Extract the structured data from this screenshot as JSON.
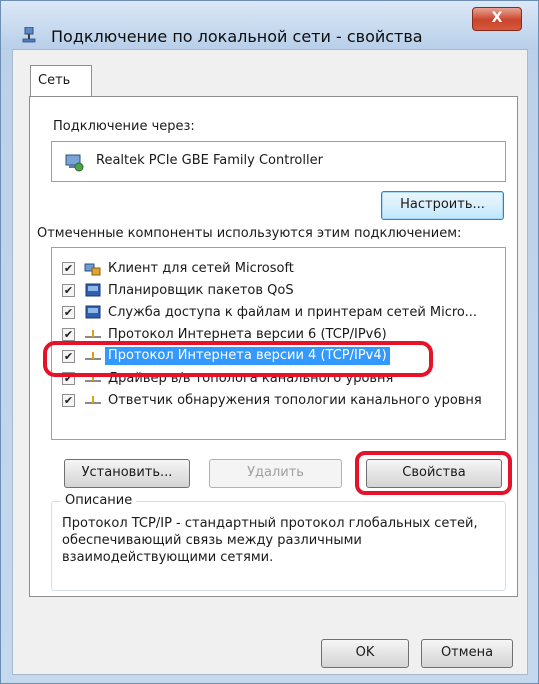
{
  "window": {
    "title": "Подключение по локальной сети - свойства",
    "close_label": "X"
  },
  "tabs": [
    {
      "label": "Сеть",
      "selected": true
    }
  ],
  "connect_using": {
    "label": "Подключение через:",
    "adapter_name": "Realtek PCIe GBE Family Controller",
    "configure_button": "Настроить..."
  },
  "components": {
    "label": "Отмеченные компоненты используются этим подключением:",
    "items": [
      {
        "label": "Клиент для сетей Microsoft",
        "checked": true,
        "icon": "network-client-icon",
        "selected": false
      },
      {
        "label": "Планировщик пакетов QoS",
        "checked": true,
        "icon": "network-service-icon",
        "selected": false
      },
      {
        "label": "Служба доступа к файлам и принтерам сетей Micro...",
        "checked": true,
        "icon": "network-service-icon",
        "selected": false
      },
      {
        "label": "Протокол Интернета версии 6 (TCP/IPv6)",
        "checked": true,
        "icon": "protocol-icon",
        "selected": false
      },
      {
        "label": "Протокол Интернета версии 4 (TCP/IPv4)",
        "checked": true,
        "icon": "protocol-icon",
        "selected": true
      },
      {
        "label": "Драйвер в/в тополога канального уровня",
        "checked": true,
        "icon": "protocol-icon",
        "selected": false
      },
      {
        "label": "Ответчик обнаружения топологии канального уровня",
        "checked": true,
        "icon": "protocol-icon",
        "selected": false
      }
    ]
  },
  "actions": {
    "install": "Установить...",
    "uninstall": "Удалить",
    "properties": "Свойства"
  },
  "description": {
    "title": "Описание",
    "text": "Протокол TCP/IP - стандартный протокол глобальных сетей, обеспечивающий связь между различными взаимодействующими сетями."
  },
  "footer": {
    "ok": "OK",
    "cancel": "Отмена"
  },
  "colors": {
    "selection": "#3399ff",
    "annotation_red": "#e5122a",
    "title_bar": "#c9dbee"
  }
}
